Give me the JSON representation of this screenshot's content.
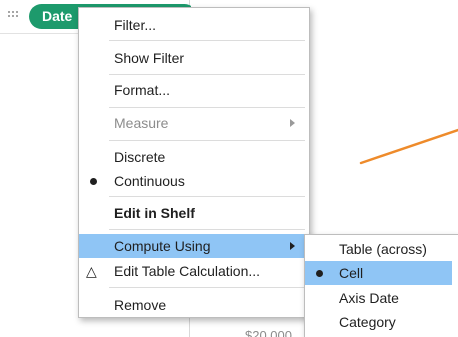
{
  "shelf": {
    "pill_label": "Date",
    "pill_color": "#1d9a6c"
  },
  "viz": {
    "axis_label": "$20,000",
    "line_color": "#ee8b2b"
  },
  "context_menu": {
    "highlight_color": "#8fc5f5",
    "items": {
      "filter": "Filter...",
      "show_filter": "Show Filter",
      "format": "Format...",
      "measure": "Measure",
      "discrete": "Discrete",
      "continuous": "Continuous",
      "edit_in_shelf": "Edit in Shelf",
      "compute_using": "Compute Using",
      "edit_table_calc": "Edit Table Calculation...",
      "remove": "Remove"
    },
    "selected_type": "Continuous",
    "delta_icon": "△"
  },
  "compute_using_submenu": {
    "items": [
      "Table (across)",
      "Cell",
      "Axis Date",
      "Category"
    ],
    "selected": "Cell"
  }
}
